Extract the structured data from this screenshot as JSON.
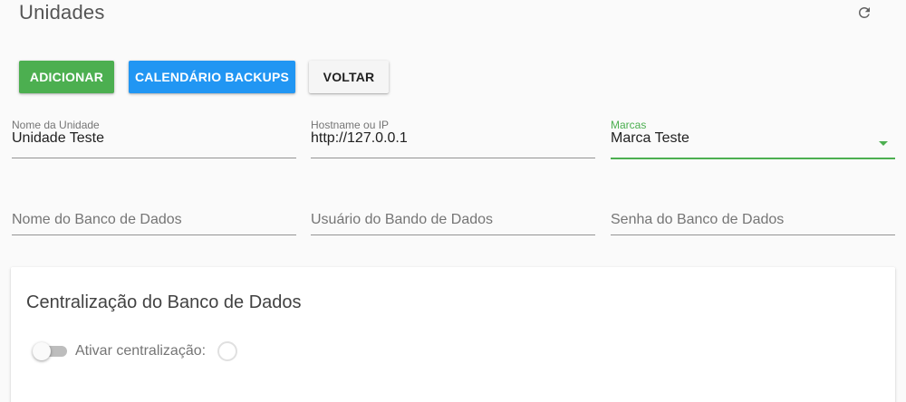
{
  "header": {
    "title": "Unidades",
    "refresh_icon": "refresh-icon"
  },
  "actions": {
    "add_label": "ADICIONAR",
    "calendar_label": "CALENDÁRIO BACKUPS",
    "back_label": "VOLTAR",
    "add_color": "#4caf50",
    "calendar_color": "#2196f3"
  },
  "form": {
    "unit_name": {
      "label": "Nome da Unidade",
      "value": "Unidade Teste"
    },
    "hostname": {
      "label": "Hostname ou IP",
      "value": "http://127.0.0.1"
    },
    "brand": {
      "label": "Marcas",
      "value": "Marca Teste",
      "icon": "dropdown-arrow-icon",
      "accent": "#4caf50"
    },
    "db_name": {
      "placeholder": "Nome do Banco de Dados",
      "value": ""
    },
    "db_user": {
      "placeholder": "Usuário do Bando de Dados",
      "value": ""
    },
    "db_password": {
      "placeholder": "Senha do Banco de Dados",
      "value": ""
    }
  },
  "centralization": {
    "title": "Centralização do Banco de Dados",
    "toggle_label": "Ativar centralização:",
    "enabled": false
  }
}
